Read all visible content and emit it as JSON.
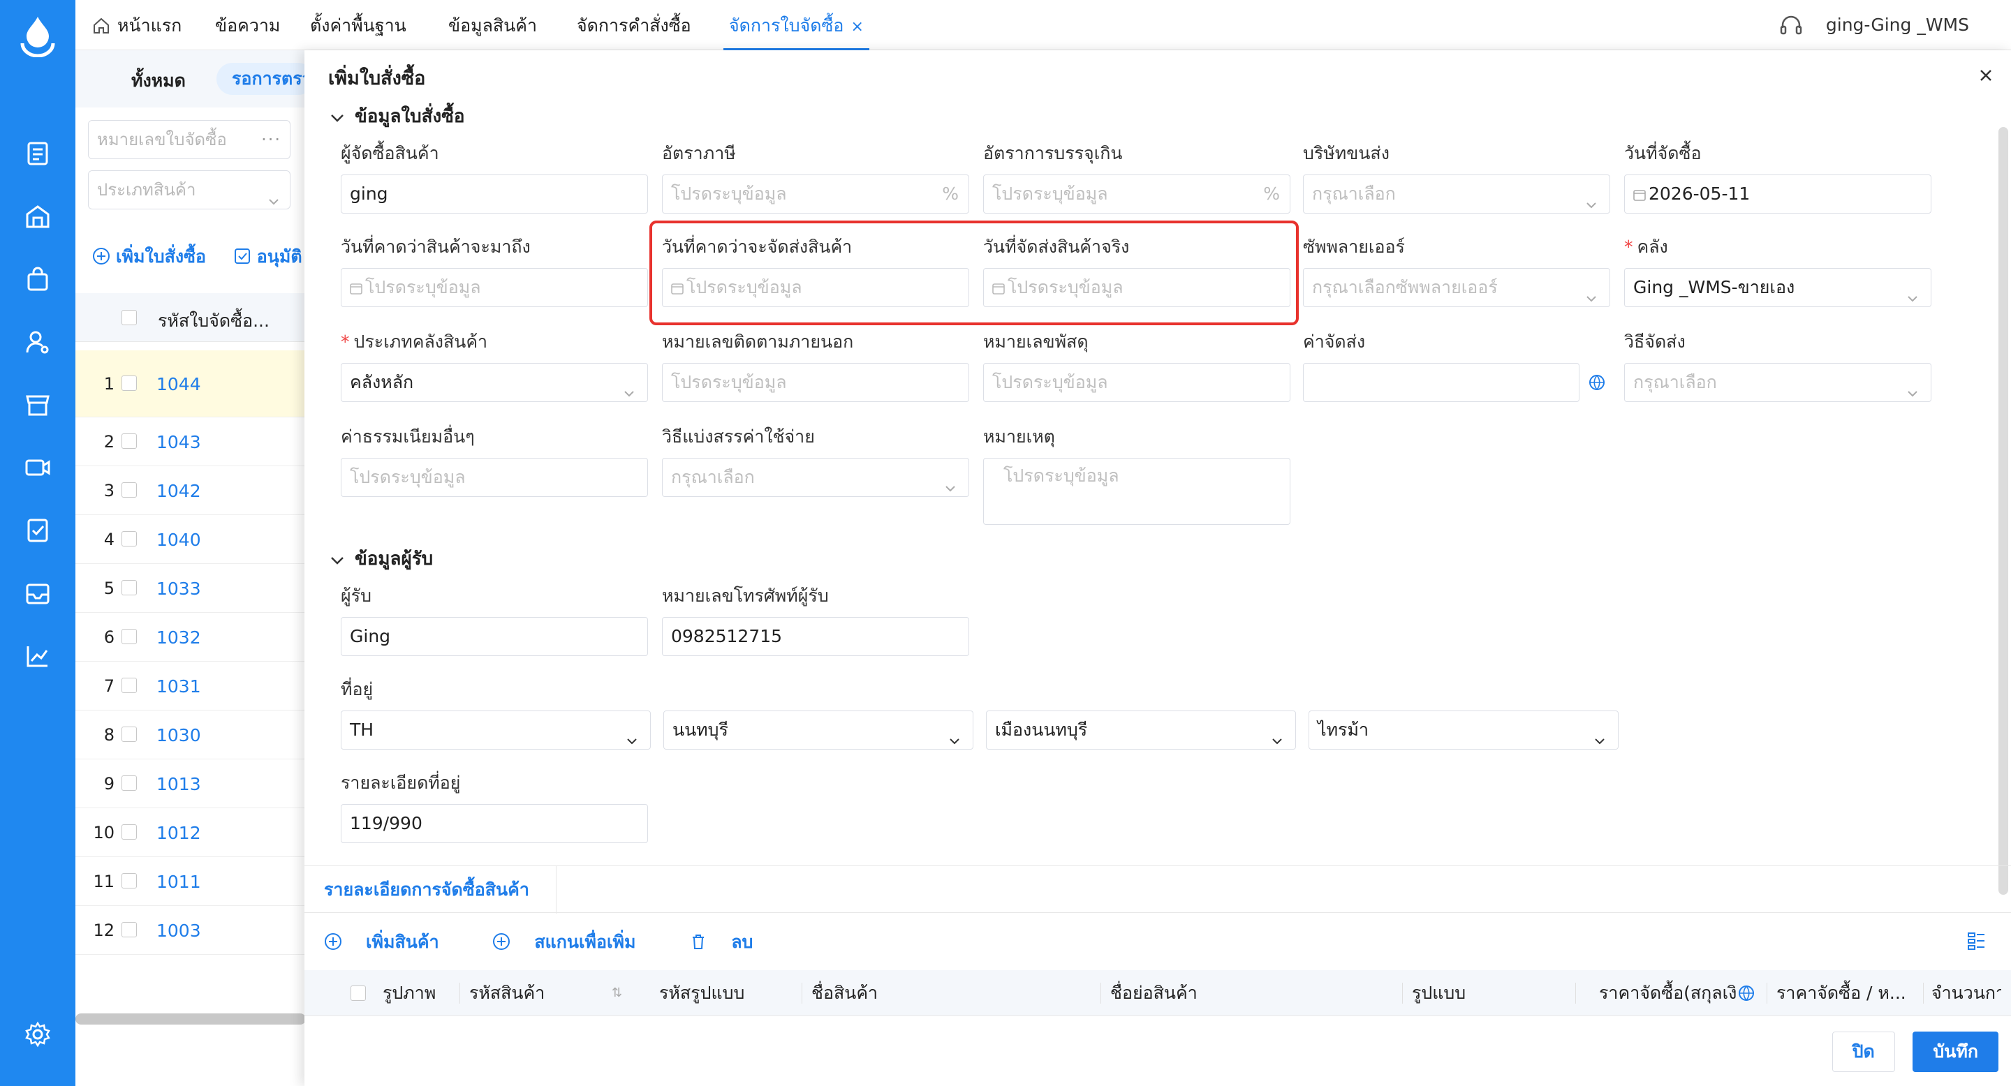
{
  "topbar": {
    "tabs": [
      {
        "label": "หน้าแรก"
      },
      {
        "label": "ข้อความ"
      },
      {
        "label": "ตั้งค่าพื้นฐาน"
      },
      {
        "label": "ข้อมูลสินค้า"
      },
      {
        "label": "จัดการคำสั่งซื้อ"
      },
      {
        "label": "จัดการใบจัดซื้อ",
        "close": "×"
      }
    ],
    "user": "ging-Ging _WMS"
  },
  "list": {
    "status_all": "ทั้งหมด",
    "status_pending": "รอการตรวจสอบ",
    "filter_po_placeholder": "หมายเลขใบจัดซื้อ",
    "filter_po_more": "···",
    "filter_type_placeholder": "ประเภทสินค้า",
    "add_po": "เพิ่มใบสั่งซื้อ",
    "approve": "อนุมัติ",
    "col_po_code": "รหัสใบจัดซื้อ...",
    "rows": [
      {
        "idx": "1",
        "no": "1044"
      },
      {
        "idx": "2",
        "no": "1043"
      },
      {
        "idx": "3",
        "no": "1042"
      },
      {
        "idx": "4",
        "no": "1040"
      },
      {
        "idx": "5",
        "no": "1033"
      },
      {
        "idx": "6",
        "no": "1032"
      },
      {
        "idx": "7",
        "no": "1031"
      },
      {
        "idx": "8",
        "no": "1030"
      },
      {
        "idx": "9",
        "no": "1013"
      },
      {
        "idx": "10",
        "no": "1012"
      },
      {
        "idx": "11",
        "no": "1011"
      },
      {
        "idx": "12",
        "no": "1003"
      }
    ]
  },
  "drawer": {
    "title": "เพิ่มใบสั่งซื้อ",
    "section_po": "ข้อมูลใบสั่งซื้อ",
    "section_receiver": "ข้อมูลผู้รับ",
    "placeholder_input": "โปรดระบุข้อมูล",
    "placeholder_select": "กรุณาเลือก",
    "fields": {
      "buyer": {
        "label": "ผู้จัดซื้อสินค้า",
        "value": "ging"
      },
      "tax_rate": {
        "label": "อัตราภาษี",
        "suffix": "%"
      },
      "overpack_rate": {
        "label": "อัตราการบรรจุเกิน",
        "suffix": "%"
      },
      "carrier": {
        "label": "บริษัทขนส่ง"
      },
      "po_date": {
        "label": "วันที่จัดซื้อ",
        "value": "2026-05-11"
      },
      "eta": {
        "label": "วันที่คาดว่าสินค้าจะมาถึง"
      },
      "expected_ship": {
        "label": "วันที่คาดว่าจะจัดส่งสินค้า"
      },
      "actual_ship": {
        "label": "วันที่จัดส่งสินค้าจริง"
      },
      "supplier": {
        "label": "ซัพพลายเออร์",
        "placeholder": "กรุณาเลือกซัพพลายเออร์"
      },
      "warehouse": {
        "label": "คลัง",
        "value": "Ging _WMS-ขายเอง"
      },
      "wh_type": {
        "label": "ประเภทคลังสินค้า",
        "value": "คลังหลัก"
      },
      "external_tracking": {
        "label": "หมายเลขติดตามภายนอก"
      },
      "parcel_no": {
        "label": "หมายเลขพัสดุ"
      },
      "shipping_fee": {
        "label": "ค่าจัดส่ง"
      },
      "shipping_method": {
        "label": "วิธีจัดส่ง"
      },
      "other_fees": {
        "label": "ค่าธรรมเนียมอื่นๆ"
      },
      "allocation": {
        "label": "วิธีแบ่งสรรค่าใช้จ่าย"
      },
      "remark": {
        "label": "หมายเหตุ"
      },
      "receiver": {
        "label": "ผู้รับ",
        "value": "Ging"
      },
      "phone": {
        "label": "หมายเลขโทรศัพท์ผู้รับ",
        "value": "0982512715"
      },
      "address": {
        "label": "ที่อยู่",
        "country": "TH",
        "province": "นนทบุรี",
        "district": "เมืองนนทบุรี",
        "subdistrict": "ไทรม้า"
      },
      "address_detail": {
        "label": "รายละเอียดที่อยู่",
        "value": "119/990"
      }
    },
    "detail_tab": "รายละเอียดการจัดซื้อสินค้า",
    "toolbar": {
      "add": "เพิ่มสินค้า",
      "scan": "สแกนเพื่อเพิ่ม",
      "delete": "ลบ"
    },
    "grid_cols": [
      "รูปภาพ",
      "รหัสสินค้า",
      "รหัสรูปแบบ",
      "ชื่อสินค้า",
      "ชื่อย่อสินค้า",
      "รูปแบบ",
      "ราคาจัดซื้อ(สกุลเงิ",
      "ราคาจัดซื้อ / ห...",
      "จำนวนกา"
    ],
    "btn_close": "ปิด",
    "btn_save": "บันทึก"
  },
  "colors": {
    "primary": "#1f7de9",
    "sidebar": "#1f88f0",
    "highlight": "#e8322d"
  }
}
